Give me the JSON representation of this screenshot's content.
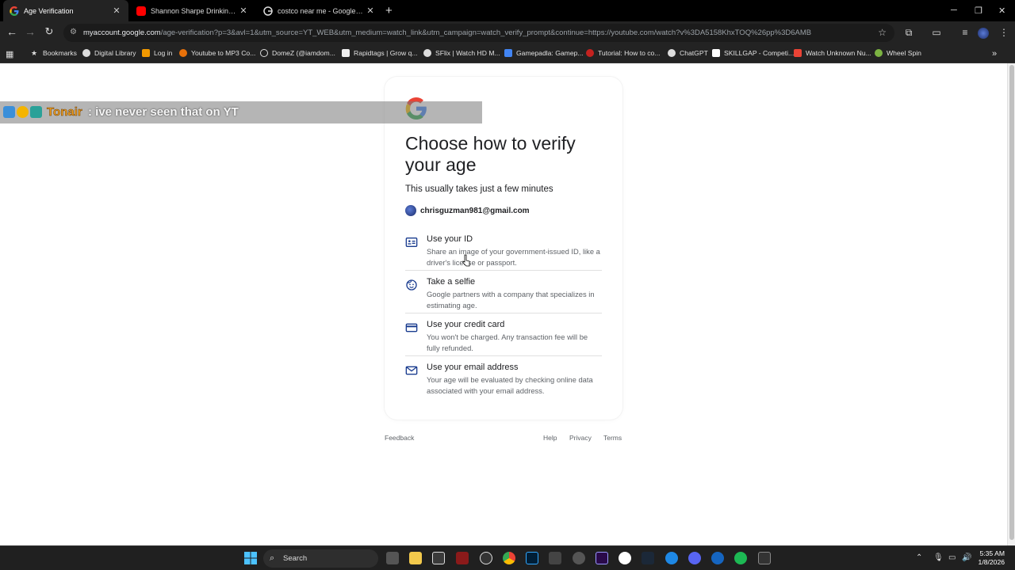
{
  "browser": {
    "tabs": [
      {
        "title": "Age Verification",
        "active": true,
        "favicon": "google-icon"
      },
      {
        "title": "Shannon Sharpe Drinking Mou",
        "active": false,
        "favicon": "youtube-icon"
      },
      {
        "title": "costco near me - Google Searc",
        "active": false,
        "favicon": "google-icon"
      }
    ],
    "url_host": "myaccount.google.com",
    "url_path": "/age-verification?p=3&avl=1&utm_source=YT_WEB&utm_medium=watch_link&utm_campaign=watch_verify_prompt&continue=https://youtube.com/watch?v%3DA5158KhxTOQ%26pp%3D6AMB",
    "bookmarks": [
      {
        "label": "Bookmarks",
        "color": "#e0e0e0"
      },
      {
        "label": "Digital Library",
        "color": "#dddddd"
      },
      {
        "label": "Log in",
        "color": "#f29900"
      },
      {
        "label": "Youtube to MP3 Co...",
        "color": "#e8710a"
      },
      {
        "label": "DomeZ (@iamdom...",
        "color": "#ffffff"
      },
      {
        "label": "Rapidtags | Grow q...",
        "color": "#ffffff"
      },
      {
        "label": "SFlix | Watch HD M...",
        "color": "#dddddd"
      },
      {
        "label": "Gamepadla: Gamep...",
        "color": "#4285f4"
      },
      {
        "label": "Tutorial: How to co...",
        "color": "#c5221f"
      },
      {
        "label": "ChatGPT",
        "color": "#dddddd"
      },
      {
        "label": "SKILLGAP - Competi...",
        "color": "#ffffff"
      },
      {
        "label": "Watch Unknown Nu...",
        "color": "#ea4335"
      },
      {
        "label": "Wheel Spin",
        "color": "#7cb342"
      }
    ]
  },
  "card": {
    "heading": "Choose how to verify your age",
    "subtitle": "This usually takes just a few minutes",
    "account_email": "chrisguzman981@gmail.com",
    "options": [
      {
        "title": "Use your ID",
        "desc": "Share an image of your government-issued ID, like a driver's license or passport.",
        "icon": "id-card-icon"
      },
      {
        "title": "Take a selfie",
        "desc": "Google partners with a company that specializes in estimating age.",
        "icon": "face-icon"
      },
      {
        "title": "Use your credit card",
        "desc": "You won't be charged. Any transaction fee will be fully refunded.",
        "icon": "credit-card-icon"
      },
      {
        "title": "Use your email address",
        "desc": "Your age will be evaluated by checking online data associated with your email address.",
        "icon": "mail-icon"
      }
    ]
  },
  "footer": {
    "feedback": "Feedback",
    "help": "Help",
    "privacy": "Privacy",
    "terms": "Terms"
  },
  "chat": {
    "username": "Tonair",
    "message": ": ive never seen that on YT"
  },
  "taskbar": {
    "search_label": "Search",
    "time": "5:35 AM",
    "date": "1/8/2026"
  }
}
